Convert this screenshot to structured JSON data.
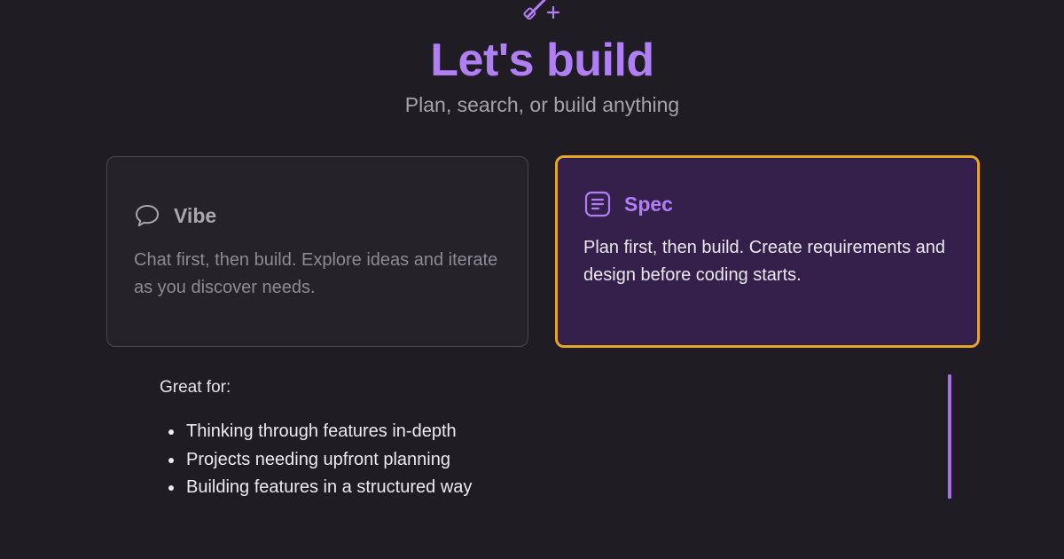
{
  "header": {
    "title": "Let's build",
    "subtitle": "Plan, search, or build anything",
    "icon": "magic-wand-icon"
  },
  "modes": [
    {
      "id": "vibe",
      "title": "Vibe",
      "icon": "chat-bubble-icon",
      "description": "Chat first, then build. Explore ideas and iterate as you discover needs.",
      "selected": false
    },
    {
      "id": "spec",
      "title": "Spec",
      "icon": "document-list-icon",
      "description": "Plan first, then build. Create requirements and design before coding starts.",
      "selected": true
    }
  ],
  "details": {
    "label": "Great for:",
    "items": [
      "Thinking through features in-depth",
      "Projects needing upfront planning",
      "Building features in a structured way"
    ]
  },
  "colors": {
    "background": "#1f1d23",
    "accent": "#b07ef5",
    "selected_border": "#e5a42a",
    "selected_card": "#34204a"
  }
}
